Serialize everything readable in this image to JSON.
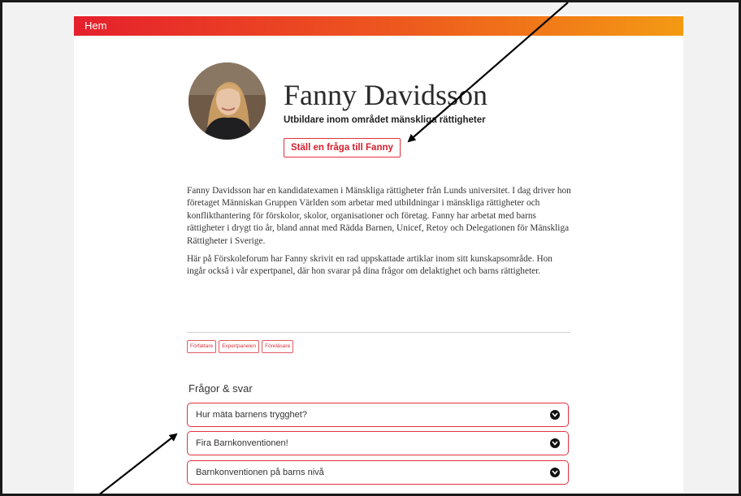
{
  "nav": {
    "home": "Hem"
  },
  "profile": {
    "name": "Fanny Davidsson",
    "subtitle": "Utbildare inom området mänskliga rättigheter",
    "ask_button": "Ställ en fråga till Fanny"
  },
  "bio": {
    "paragraph1": "Fanny Davidsson har en kandidatexamen i Mänskliga rättigheter från Lunds universitet. I dag driver hon företaget Människan Gruppen Världen som arbetar med utbildningar i mänskliga rättigheter och konflikthantering för förskolor, skolor, organisationer och företag. Fanny har arbetat med barns rättigheter i drygt tio år, bland annat med Rädda Barnen, Unicef, Retoy och Delegationen för Mänskliga Rättigheter i Sverige.",
    "paragraph2": "Här på Förskoleforum har Fanny skrivit en rad uppskattade artiklar inom sitt kunskapsområde. Hon ingår också i vår expertpanel, där hon svarar på dina frågor om delaktighet och barns rättigheter."
  },
  "tags": [
    "Författare",
    "Expertpanelen",
    "Föreläsare"
  ],
  "faq": {
    "heading": "Frågor & svar",
    "items": [
      "Hur mäta barnens trygghet?",
      "Fira Barnkonventionen!",
      "Barnkonventionen på barns nivå"
    ]
  },
  "icons": {
    "faq_toggle": "chevron-down-circle-icon"
  },
  "colors": {
    "accent": "#e0313f",
    "bar_start": "#e5202c",
    "bar_end": "#f39a13"
  }
}
